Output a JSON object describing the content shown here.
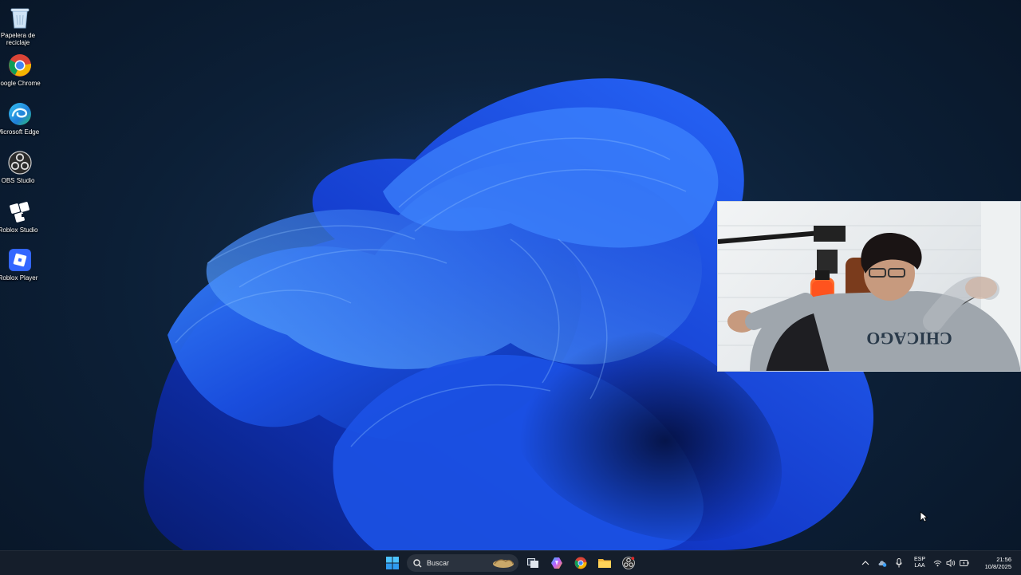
{
  "desktop": {
    "icons": [
      {
        "label": "Papelera de reciclaje",
        "icon": "recycle-bin-icon"
      },
      {
        "label": "Google Chrome",
        "icon": "chrome-icon"
      },
      {
        "label": "Microsoft Edge",
        "icon": "edge-icon"
      },
      {
        "label": "OBS Studio",
        "icon": "obs-icon"
      },
      {
        "label": "Roblox Studio",
        "icon": "roblox-studio-icon"
      },
      {
        "label": "Roblox Player",
        "icon": "roblox-player-icon"
      }
    ]
  },
  "webcam": {
    "shirt_text": "CHICAGO"
  },
  "taskbar": {
    "search_placeholder": "Buscar",
    "pinned": [
      "start-icon",
      "search-icon",
      "task-view-icon",
      "copilot-icon",
      "chrome-icon",
      "file-explorer-icon",
      "obs-icon"
    ],
    "tray": {
      "lang_primary": "ESP",
      "lang_secondary": "LAA",
      "time": "21:56",
      "date": "10/8/2025"
    }
  },
  "colors": {
    "taskbar": "#161e2c",
    "accent": "#1e6fff",
    "wallpaper": "#0c1f36"
  }
}
